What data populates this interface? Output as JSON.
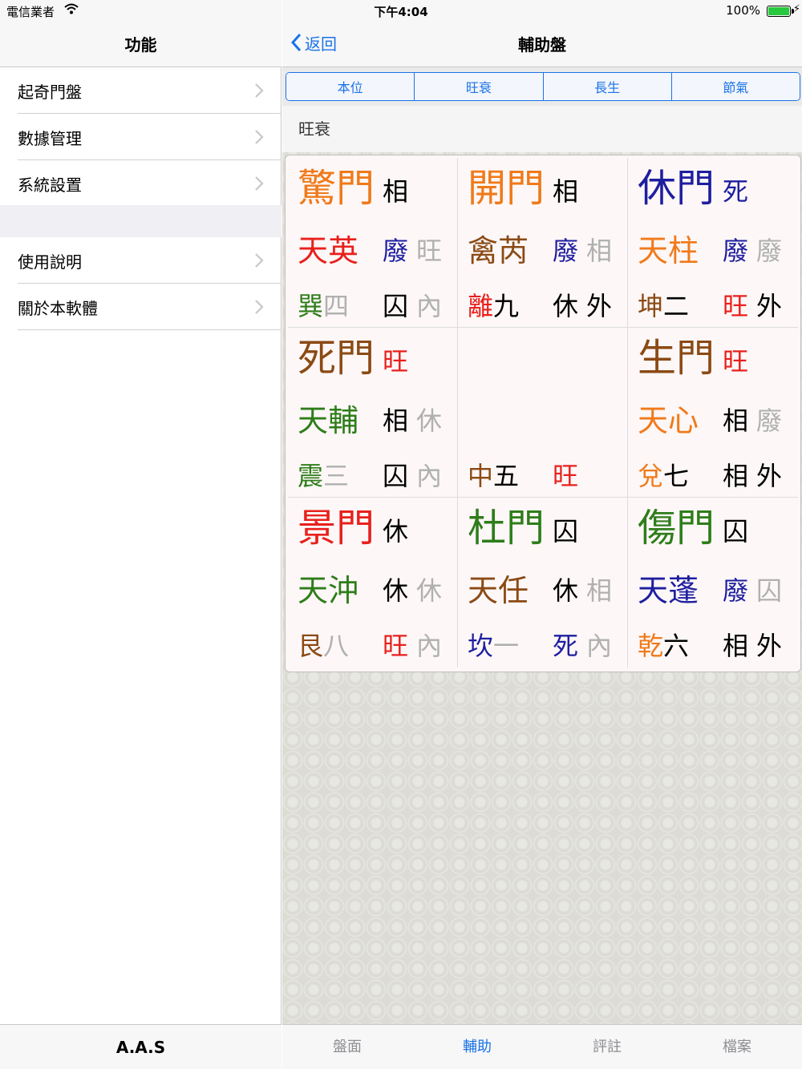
{
  "status": {
    "carrier": "電信業者",
    "time": "下午4:04",
    "battery": "100%"
  },
  "master": {
    "title": "功能",
    "group1": [
      "起奇門盤",
      "數據管理",
      "系統設置"
    ],
    "group2": [
      "使用說明",
      "關於本軟體"
    ],
    "footer": "A.A.S"
  },
  "detail": {
    "back_label": "返回",
    "title": "輔助盤",
    "segments": [
      "本位",
      "旺衰",
      "長生",
      "節氣"
    ],
    "section_label": "旺衰",
    "grid": [
      [
        {
          "door": "驚門",
          "doorColor": "#f07a1a",
          "doorState": "相",
          "doorStateColor": "#000",
          "star": "天英",
          "starColor": "#e8201c",
          "s1": "廢",
          "s1Color": "#1e1ea0",
          "s2": "旺",
          "s2Color": "#b0b0b0",
          "pal": "巽",
          "palColor": "#2e7d1a",
          "num": "四",
          "numColor": "#b0b0b0",
          "p1": "囚",
          "p1Color": "#000",
          "p2": "內",
          "p2Color": "#b0b0b0"
        },
        {
          "door": "開門",
          "doorColor": "#f07a1a",
          "doorState": "相",
          "doorStateColor": "#000",
          "star": "禽芮",
          "starColor": "#8b4a14",
          "s1": "廢",
          "s1Color": "#1e1ea0",
          "s2": "相",
          "s2Color": "#b0b0b0",
          "pal": "離",
          "palColor": "#e8201c",
          "num": "九",
          "numColor": "#000",
          "p1": "休",
          "p1Color": "#000",
          "p2": "外",
          "p2Color": "#000"
        },
        {
          "door": "休門",
          "doorColor": "#1e1ea0",
          "doorState": "死",
          "doorStateColor": "#1e1ea0",
          "star": "天柱",
          "starColor": "#f07a1a",
          "s1": "廢",
          "s1Color": "#1e1ea0",
          "s2": "廢",
          "s2Color": "#b0b0b0",
          "pal": "坤",
          "palColor": "#8b4a14",
          "num": "二",
          "numColor": "#000",
          "p1": "旺",
          "p1Color": "#e8201c",
          "p2": "外",
          "p2Color": "#000"
        }
      ],
      [
        {
          "door": "死門",
          "doorColor": "#8b4a14",
          "doorState": "旺",
          "doorStateColor": "#e8201c",
          "star": "天輔",
          "starColor": "#2e7d1a",
          "s1": "相",
          "s1Color": "#000",
          "s2": "休",
          "s2Color": "#b0b0b0",
          "pal": "震",
          "palColor": "#2e7d1a",
          "num": "三",
          "numColor": "#b0b0b0",
          "p1": "囚",
          "p1Color": "#000",
          "p2": "內",
          "p2Color": "#b0b0b0"
        },
        {
          "door": "",
          "doorColor": "#000",
          "doorState": "",
          "doorStateColor": "#000",
          "star": "",
          "starColor": "#000",
          "s1": "",
          "s1Color": "#000",
          "s2": "",
          "s2Color": "#000",
          "pal": "中",
          "palColor": "#8b4a14",
          "num": "五",
          "numColor": "#000",
          "p1": "旺",
          "p1Color": "#e8201c",
          "p2": "",
          "p2Color": "#000"
        },
        {
          "door": "生門",
          "doorColor": "#8b4a14",
          "doorState": "旺",
          "doorStateColor": "#e8201c",
          "star": "天心",
          "starColor": "#f07a1a",
          "s1": "相",
          "s1Color": "#000",
          "s2": "廢",
          "s2Color": "#b0b0b0",
          "pal": "兌",
          "palColor": "#f07a1a",
          "num": "七",
          "numColor": "#000",
          "p1": "相",
          "p1Color": "#000",
          "p2": "外",
          "p2Color": "#000"
        }
      ],
      [
        {
          "door": "景門",
          "doorColor": "#e8201c",
          "doorState": "休",
          "doorStateColor": "#000",
          "star": "天沖",
          "starColor": "#2e7d1a",
          "s1": "休",
          "s1Color": "#000",
          "s2": "休",
          "s2Color": "#b0b0b0",
          "pal": "艮",
          "palColor": "#8b4a14",
          "num": "八",
          "numColor": "#b0b0b0",
          "p1": "旺",
          "p1Color": "#e8201c",
          "p2": "內",
          "p2Color": "#b0b0b0"
        },
        {
          "door": "杜門",
          "doorColor": "#2e7d1a",
          "doorState": "囚",
          "doorStateColor": "#000",
          "star": "天任",
          "starColor": "#8b4a14",
          "s1": "休",
          "s1Color": "#000",
          "s2": "相",
          "s2Color": "#b0b0b0",
          "pal": "坎",
          "palColor": "#1e1ea0",
          "num": "一",
          "numColor": "#b0b0b0",
          "p1": "死",
          "p1Color": "#1e1ea0",
          "p2": "內",
          "p2Color": "#b0b0b0"
        },
        {
          "door": "傷門",
          "doorColor": "#2e7d1a",
          "doorState": "囚",
          "doorStateColor": "#000",
          "star": "天蓬",
          "starColor": "#1e1ea0",
          "s1": "廢",
          "s1Color": "#1e1ea0",
          "s2": "囚",
          "s2Color": "#b0b0b0",
          "pal": "乾",
          "palColor": "#f07a1a",
          "num": "六",
          "numColor": "#000",
          "p1": "相",
          "p1Color": "#000",
          "p2": "外",
          "p2Color": "#000"
        }
      ]
    ]
  },
  "tabs": [
    "盤面",
    "輔助",
    "評註",
    "檔案"
  ]
}
